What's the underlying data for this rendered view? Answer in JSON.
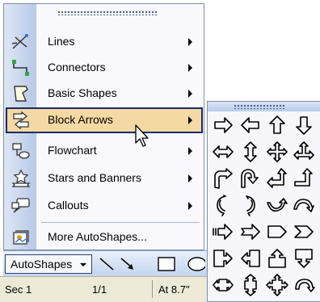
{
  "menu": {
    "items": [
      {
        "name": "lines",
        "label": "Lines",
        "icon": "lines-icon",
        "submenu": true
      },
      {
        "name": "connectors",
        "label": "Connectors",
        "icon": "connectors-icon",
        "submenu": true
      },
      {
        "name": "basic-shapes",
        "label": "Basic Shapes",
        "icon": "basic-shapes-icon",
        "submenu": true
      },
      {
        "name": "block-arrows",
        "label": "Block Arrows",
        "icon": "block-arrows-icon",
        "submenu": true,
        "selected": true
      },
      {
        "name": "flowchart",
        "label": "Flowchart",
        "icon": "flowchart-icon",
        "submenu": true
      },
      {
        "name": "stars-and-banners",
        "label": "Stars and Banners",
        "icon": "stars-banners-icon",
        "submenu": true
      },
      {
        "name": "callouts",
        "label": "Callouts",
        "icon": "callouts-icon",
        "submenu": true
      },
      {
        "name": "more-autoshapes",
        "label": "More AutoShapes...",
        "icon": "clip-art-icon",
        "submenu": false
      }
    ]
  },
  "toolbar": {
    "autoshapes_label": "AutoShapes",
    "tools": [
      "line-icon",
      "arrow-icon",
      "rectangle-icon",
      "oval-icon"
    ]
  },
  "statusbar": {
    "section": "Sec  1",
    "page": "1/1",
    "at": "At  8.7\""
  },
  "palette": {
    "shapes": [
      "right-arrow-icon",
      "left-arrow-icon",
      "up-arrow-icon",
      "down-arrow-icon",
      "left-right-arrow-icon",
      "up-down-arrow-icon",
      "quad-arrow-icon",
      "left-right-up-arrow-icon",
      "bent-arrow-icon",
      "u-turn-arrow-icon",
      "left-up-arrow-icon",
      "bent-up-arrow-icon",
      "curved-right-arrow-icon",
      "curved-left-arrow-icon",
      "curved-up-arrow-icon",
      "curved-down-arrow-icon",
      "striped-right-arrow-icon",
      "notched-right-arrow-icon",
      "pentagon-icon",
      "chevron-icon",
      "right-arrow-callout-icon",
      "left-arrow-callout-icon",
      "up-arrow-callout-icon",
      "down-arrow-callout-icon",
      "left-right-arrow-callout-icon",
      "up-down-arrow-callout-icon",
      "quad-arrow-callout-icon",
      "circular-arrow-icon"
    ]
  }
}
